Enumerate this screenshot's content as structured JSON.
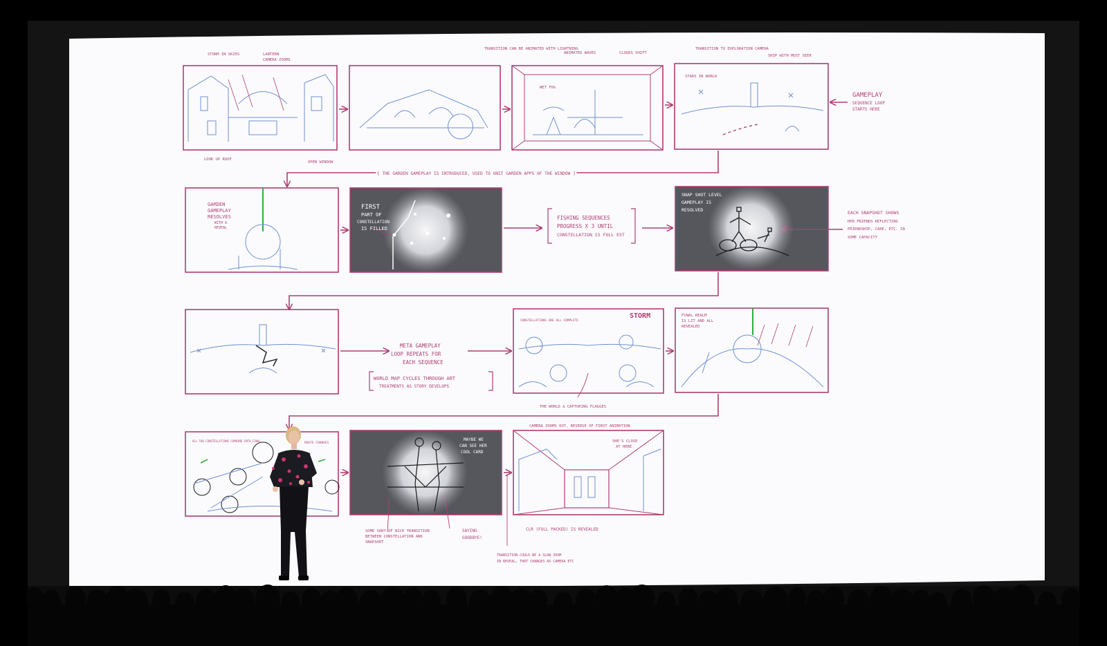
{
  "colors": {
    "background": "#000000",
    "stage_frame": "#141414",
    "screen": "#fbfbfd",
    "frame_line": "#b03d72",
    "sketch_blue": "#6d8fd2",
    "dark_panel": "#55575d",
    "glow": "#e8e9ef",
    "green_line": "#2fae3c",
    "dress": "#1b1b22",
    "floral": "#c9376c"
  },
  "storyboard": {
    "row1": {
      "panel1_notes": [
        "STORM IN SKIES",
        "LANTERN",
        "CAMERA ZOOMS",
        "LOOK UP ROOF",
        "OPEN WINDOW"
      ],
      "panel2_notes": [
        "TRANSITION CAN BE ANIMATED WITH LIGHTNING"
      ],
      "panel3_notes": [
        "ANIMATED WAVES",
        "CLOUDS SHIFT",
        "WET FOG"
      ],
      "panel4_notes": [
        "TRANSITION TO EXPLORATION CAMERA",
        "SHIP WITH MUST SEEK",
        "STARS IN WORLD"
      ],
      "side_title": "GAMEPLAY",
      "side_lines": [
        "SEQUENCE LOOP",
        "STARTS HERE"
      ],
      "connector_note": "[ THE GARDEN GAMEPLAY IS INTRODUCED, USED TO UNIT GARDEN APPS OF THE WINDOW ]"
    },
    "row2": {
      "panel1_notes": [
        "GARDEN",
        "GAMEPLAY",
        "RESOLVES",
        "WITH A",
        "REVEAL"
      ],
      "panel2_notes": [
        "FIRST",
        "PART OF",
        "CONSTELLATION",
        "IS FILLED"
      ],
      "bracket_lines": [
        "FISHING SEQUENCES",
        "PROGRESS X 3 UNTIL",
        "CONSTELLATION IS FULL EST"
      ],
      "panel4_notes": [
        "SNAP SHOT LEVEL",
        "GAMEPLAY IS",
        "RESOLVED"
      ],
      "side_lines": [
        "EACH SNAPSHOT SHOWS",
        "HER FRIENDS REFLECTING",
        "FRIENDSHIP, CARE, ETC. IN",
        "SOME CAPACITY"
      ]
    },
    "row3": {
      "middle_lines": [
        "META GAMEPLAY",
        "LOOP REPEATS FOR",
        "EACH SEQUENCE"
      ],
      "bracket_lines": [
        "WORLD MAP CYCLES THROUGH ART",
        "TREATMENTS AS STORY DEVELOPS"
      ],
      "storm_label": "STORM",
      "storm_notes": [
        "CONSTELLATIONS ARE ALL COMPLETE",
        "THE WORLD & CAPTURING FLAGGES"
      ],
      "panel4_notes": [
        "FINAL REALM",
        "IS LIT AND ALL",
        "REVEALED"
      ]
    },
    "row4": {
      "panel1_notes": [
        "ALL THE CONSTELLATIONS COMBINE INTO FINAL",
        "ROUTE CHANGES"
      ],
      "panel2_notes": [
        "MAYBE WE",
        "CAN SEE HER",
        "COOL CARD"
      ],
      "panel2_bottom": [
        "SOME SORT OF NICE TRANSITION",
        "BETWEEN CONSTELLATION AND",
        "SNAPSHOT"
      ],
      "panel2_bottom_right": [
        "SAYING",
        "GOODBYE!"
      ],
      "panel3_top": "CAMERA ZOOMS OUT, REVERSE OF FIRST ANIMATION",
      "panel3_note": [
        "SHE'S CLOSE",
        "AT HERE"
      ],
      "panel3_bottom": "CLR (FULL PACKED) IS REVEALED",
      "footer_lines": [
        "TRANSITION COULD BE A SLOW ZOOM",
        "IN REVEAL, THAT CHANGES AS CAMERA ETC"
      ]
    }
  }
}
